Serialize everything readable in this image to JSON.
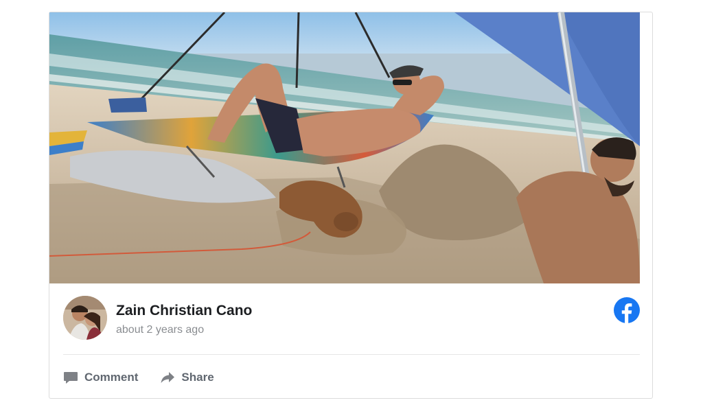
{
  "post": {
    "author_name": "Zain Christian Cano",
    "timestamp": "about 2 years ago",
    "source_icon": "facebook-icon",
    "brand_color": "#1877f2"
  },
  "actions": [
    {
      "label": "Comment",
      "icon": "comment-icon"
    },
    {
      "label": "Share",
      "icon": "share-icon"
    }
  ]
}
